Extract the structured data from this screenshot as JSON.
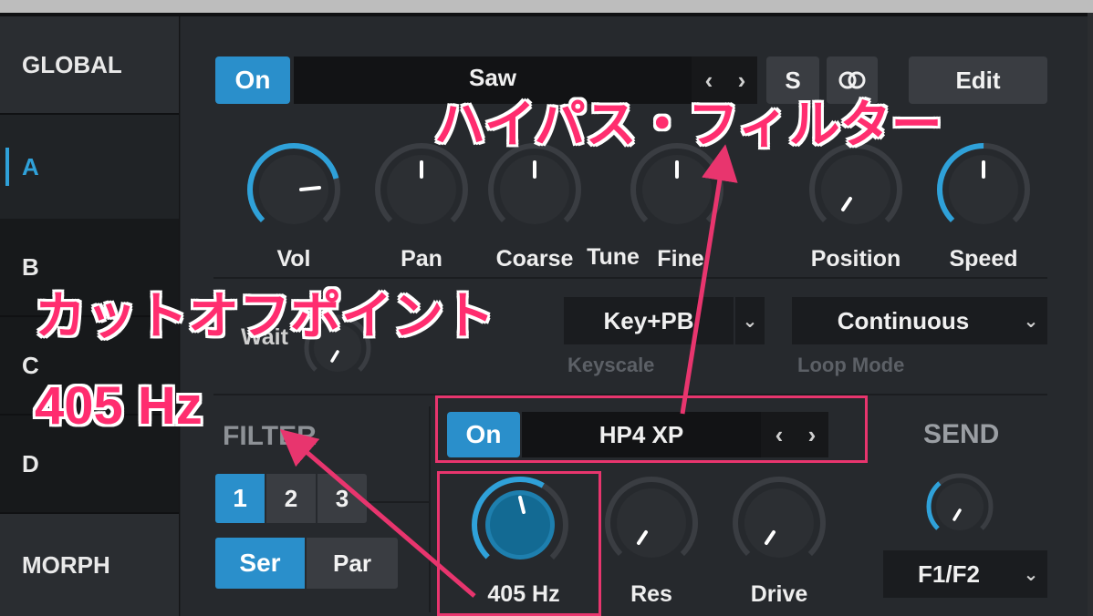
{
  "sidebar": {
    "items": [
      {
        "label": "GLOBAL"
      },
      {
        "label": "A"
      },
      {
        "label": "B"
      },
      {
        "label": "C"
      },
      {
        "label": "D"
      },
      {
        "label": "MORPH"
      }
    ]
  },
  "osc": {
    "on_label": "On",
    "waveform": "Saw",
    "s_label": "S",
    "edit_label": "Edit",
    "knobs": [
      {
        "label": "Vol"
      },
      {
        "label": "Pan"
      },
      {
        "label": "Coarse"
      },
      {
        "label": "Tune"
      },
      {
        "label": "Fine"
      },
      {
        "label": "Position"
      },
      {
        "label": "Speed"
      }
    ],
    "wait_label": "Wait",
    "keyscale_value": "Key+PB",
    "keyscale_label": "Keyscale",
    "loopmode_value": "Continuous",
    "loopmode_label": "Loop Mode"
  },
  "filter": {
    "title": "FILTER",
    "num_buttons": [
      "1",
      "2",
      "3"
    ],
    "ser_label": "Ser",
    "par_label": "Par",
    "on_label": "On",
    "type": "HP4 XP",
    "knobs": [
      {
        "label": "405 Hz"
      },
      {
        "label": "Res"
      },
      {
        "label": "Drive"
      }
    ]
  },
  "send": {
    "title": "SEND",
    "value": "F1/F2"
  },
  "annotations": {
    "highpass": "ハイパス・フィルター",
    "cutoff": "カットオフポイント",
    "cutoff_value": "405 Hz"
  },
  "colors": {
    "accent": "#2fa1d9",
    "annotation": "#ff2d6f",
    "panel": "#26292d"
  }
}
